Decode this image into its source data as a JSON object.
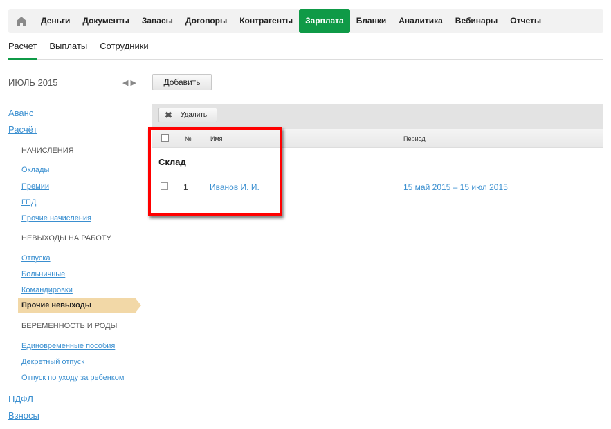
{
  "topnav": {
    "items": [
      "Деньги",
      "Документы",
      "Запасы",
      "Договоры",
      "Контрагенты",
      "Зарплата",
      "Бланки",
      "Аналитика",
      "Вебинары",
      "Отчеты"
    ],
    "active": "Зарплата"
  },
  "subnav": {
    "tabs": [
      "Расчет",
      "Выплаты",
      "Сотрудники"
    ],
    "active": "Расчет"
  },
  "period": {
    "month": "ИЮЛЬ 2015"
  },
  "add_label": "Добавить",
  "delete_label": "Удалить",
  "sidebar": {
    "avans": "Аванс",
    "raschet": "Расчёт",
    "h1": "НАЧИСЛЕНИЯ",
    "oklady": "Оклады",
    "premii": "Премии",
    "gpd": "ГПД",
    "prochie_nach": "Прочие начисления",
    "h2": "НЕВЫХОДЫ НА РАБОТУ",
    "otpuska": "Отпуска",
    "bolnichnye": "Больничные",
    "komandirovki": "Командировки",
    "prochie_nev": "Прочие невыходы",
    "h3": "БЕРЕМЕННОСТЬ И РОДЫ",
    "edinovr": "Единовременные пособия",
    "dekret": "Декретный отпуск",
    "uhod": "Отпуск по уходу за ребенком",
    "ndfl": "НДФЛ",
    "vznosy": "Взносы"
  },
  "table": {
    "columns": {
      "num": "№",
      "name": "Имя",
      "period": "Период"
    },
    "group": "Склад",
    "rows": [
      {
        "num": "1",
        "name": "Иванов И. И.",
        "period": "15 май 2015 – 15 июл 2015"
      }
    ]
  }
}
